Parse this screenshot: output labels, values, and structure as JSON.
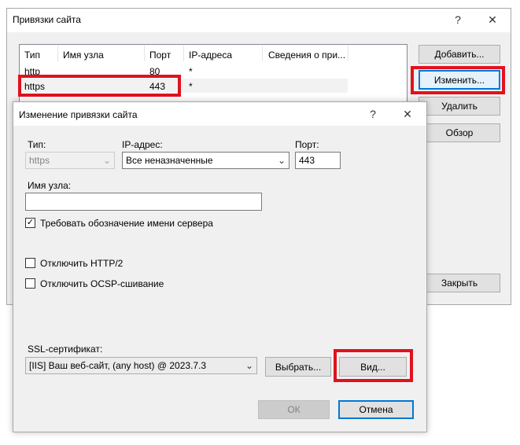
{
  "bindings_dialog": {
    "title": "Привязки сайта",
    "help_glyph": "?",
    "close_glyph": "✕",
    "columns": [
      "Тип",
      "Имя узла",
      "Порт",
      "IP-адреса",
      "Сведения о при..."
    ],
    "rows": [
      {
        "type": "http",
        "host": "",
        "port": "80",
        "ip": "*",
        "info": ""
      },
      {
        "type": "https",
        "host": "",
        "port": "443",
        "ip": "*",
        "info": ""
      }
    ],
    "buttons": {
      "add": "Добавить...",
      "edit": "Изменить...",
      "remove": "Удалить",
      "browse": "Обзор",
      "close": "Закрыть"
    }
  },
  "edit_dialog": {
    "title": "Изменение привязки сайта",
    "help_glyph": "?",
    "close_glyph": "✕",
    "type_label": "Тип:",
    "type_value": "https",
    "ip_label": "IP-адрес:",
    "ip_value": "Все неназначенные",
    "port_label": "Порт:",
    "port_value": "443",
    "host_label": "Имя узла:",
    "host_value": "",
    "sni_label": "Требовать обозначение имени сервера",
    "sni_checked": true,
    "http2_label": "Отключить HTTP/2",
    "http2_checked": false,
    "ocsp_label": "Отключить OCSP-сшивание",
    "ocsp_checked": false,
    "ssl_label": "SSL-сертификат:",
    "ssl_value": "[IIS] Ваш веб-сайт, (any host) @ 2023.7.3",
    "select_button": "Выбрать...",
    "view_button": "Вид...",
    "ok_button": "ОК",
    "cancel_button": "Отмена",
    "check_glyph": "✓",
    "dropdown_glyph": "⌄"
  },
  "colors": {
    "highlight": "#e0121e",
    "focus_border": "#0078d7",
    "dialog_bg": "#f0f0f0"
  }
}
